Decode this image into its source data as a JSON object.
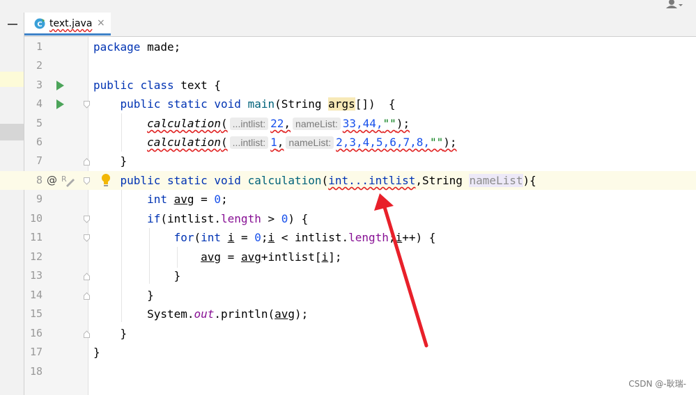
{
  "tab": {
    "label": "text.java",
    "close": "×"
  },
  "lines": [
    {
      "n": "1"
    },
    {
      "n": "2"
    },
    {
      "n": "3"
    },
    {
      "n": "4"
    },
    {
      "n": "5"
    },
    {
      "n": "6"
    },
    {
      "n": "7"
    },
    {
      "n": "8"
    },
    {
      "n": "9"
    },
    {
      "n": "10"
    },
    {
      "n": "11"
    },
    {
      "n": "12"
    },
    {
      "n": "13"
    },
    {
      "n": "14"
    },
    {
      "n": "15"
    },
    {
      "n": "16"
    },
    {
      "n": "17"
    },
    {
      "n": "18"
    }
  ],
  "code": {
    "l1": {
      "kw": "package",
      "rest": " made;"
    },
    "l3": {
      "kw1": "public",
      "kw2": "class",
      "rest": " text {"
    },
    "l4": {
      "kw1": "public",
      "kw2": "static",
      "kw3": "void",
      "fn": "main",
      "p1": "(String ",
      "arg": "args",
      "p2": "[])  {"
    },
    "l5": {
      "fn": "calculation",
      "open": "(",
      "hint1": "...intlist:",
      "v1": "22",
      "comma": ",",
      "hint2": "nameList:",
      "v2": "33,44,",
      "str": "\"\"",
      "close": ");"
    },
    "l6": {
      "fn": "calculation",
      "open": "(",
      "hint1": "...intlist:",
      "v1": "1",
      "comma": ",",
      "hint2": "nameList:",
      "v2": "2,3,4,5,6,7,8,",
      "str": "\"\"",
      "close": ");"
    },
    "l7": {
      "text": "}"
    },
    "l8": {
      "kw1": "public",
      "kw2": "static",
      "kw3": "void",
      "fn": "calculation",
      "open": "(",
      "sig": "int...intlist",
      "mid": ",String ",
      "param": "nameList",
      "close": "){"
    },
    "l9": {
      "kw": "int",
      "var": "avg",
      "eq": " = ",
      "num": "0",
      "semi": ";"
    },
    "l10": {
      "kw": "if",
      "p1": "(intlist.",
      "fld": "length",
      "p2": " > ",
      "num": "0",
      "p3": ") {"
    },
    "l11": {
      "kw": "for",
      "p1": "(",
      "kw2": "int",
      "sp": " ",
      "i1": "i",
      "eq": " = ",
      "num": "0",
      "semi": ";",
      "i2": "i",
      "p2": " < intlist.",
      "fld": "length",
      "semi2": ";",
      "i3": "i",
      "p3": "++) {"
    },
    "l12": {
      "v1": "avg",
      "eq": " = ",
      "v2": "avg",
      "rest": "+intlist[",
      "i": "i",
      "end": "];"
    },
    "l13": {
      "text": "}"
    },
    "l14": {
      "text": "}"
    },
    "l15": {
      "p1": "System.",
      "fld": "out",
      "p2": ".println(",
      "var": "avg",
      "p3": ");"
    },
    "l16": {
      "text": "}"
    },
    "l17": {
      "text": "}"
    }
  },
  "gutter_icons": {
    "at": "@"
  },
  "watermark": "CSDN @-耿瑞-",
  "colors": {
    "keyword": "#0033b3",
    "number": "#1750eb",
    "string": "#067d17",
    "field": "#871094",
    "arrow": "#e8202a"
  }
}
